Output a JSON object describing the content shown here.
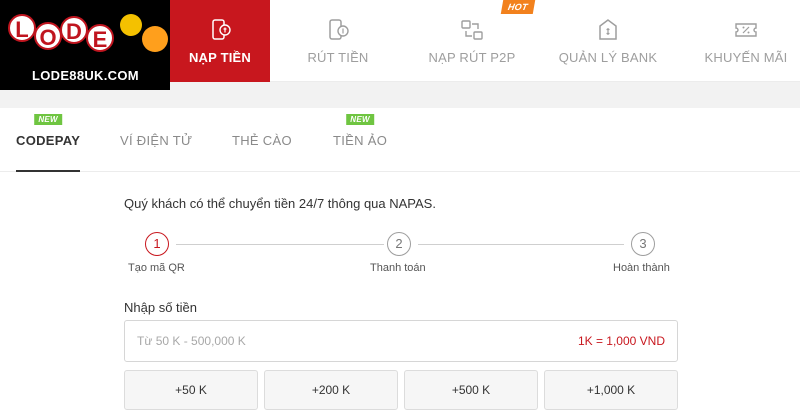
{
  "logo": {
    "letters": [
      "L",
      "O",
      "D",
      "E"
    ],
    "site": "LODE88UK.COM"
  },
  "nav": {
    "items": [
      {
        "label": "NẠP TIỀN",
        "icon": "phone-deposit-icon"
      },
      {
        "label": "RÚT TIỀN",
        "icon": "phone-withdraw-icon"
      },
      {
        "label": "NẠP RÚT P2P",
        "icon": "p2p-transfer-icon",
        "badge": "HOT"
      },
      {
        "label": "QUẢN LÝ BANK",
        "icon": "bank-icon"
      },
      {
        "label": "KHUYẾN MÃI",
        "icon": "promotion-ticket-icon"
      }
    ],
    "active_color": "#c8171e"
  },
  "tabs": [
    {
      "label": "CODEPAY",
      "badge": "NEW"
    },
    {
      "label": "VÍ ĐIỆN TỬ"
    },
    {
      "label": "THẺ CÀO"
    },
    {
      "label": "TIỀN ẢO",
      "badge": "NEW"
    }
  ],
  "intro": "Quý khách có thể chuyển tiền 24/7 thông qua NAPAS.",
  "steps": [
    {
      "number": "1",
      "label": "Tạo mã QR"
    },
    {
      "number": "2",
      "label": "Thanh toán"
    },
    {
      "number": "3",
      "label": "Hoàn thành"
    }
  ],
  "amount": {
    "label": "Nhập số tiền",
    "placeholder": "Từ 50 K - 500,000 K",
    "value": "",
    "rate": "1K = 1,000 VND"
  },
  "quick_amounts": [
    "+50 K",
    "+200 K",
    "+500 K",
    "+1,000 K"
  ]
}
